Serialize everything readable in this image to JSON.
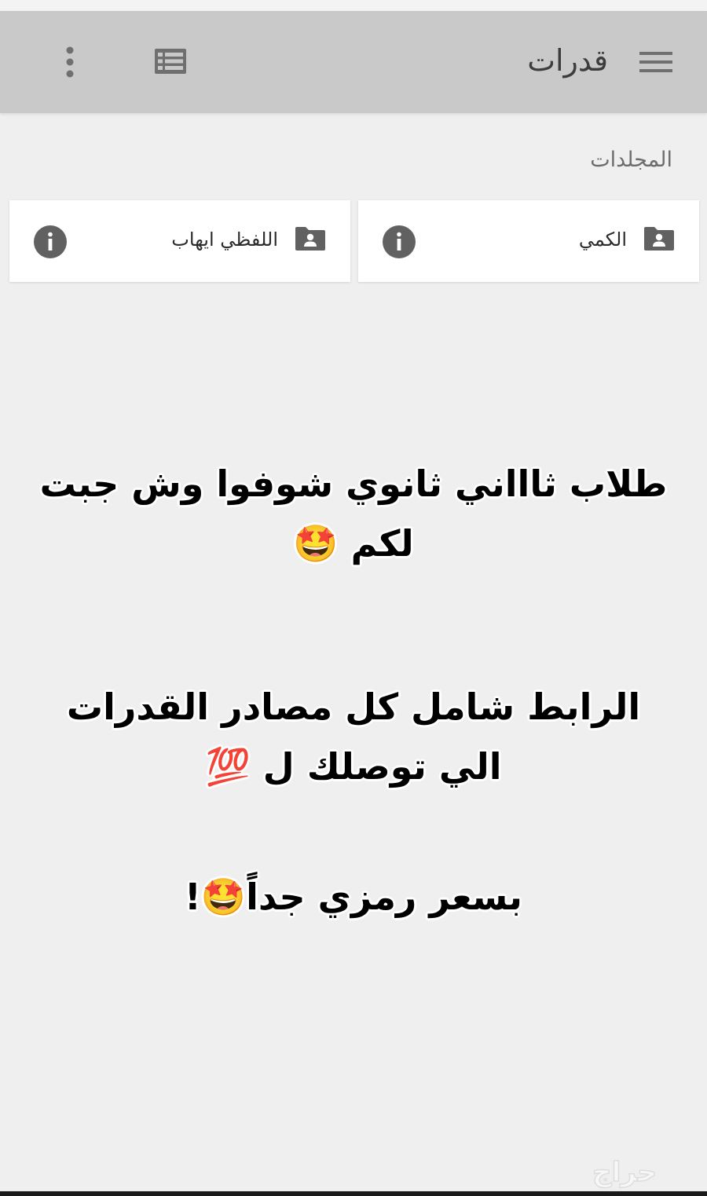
{
  "app_bar": {
    "title": "قدرات",
    "background": "#c9c9c9"
  },
  "folders_section": {
    "label": "المجلدات",
    "items": [
      {
        "name": "الكمي",
        "icon": "shared-folder-icon"
      },
      {
        "name": "اللفظي ايهاب",
        "icon": "shared-folder-icon"
      }
    ]
  },
  "overlay": {
    "line1": "طلاب ثاااني ثانوي شوفوا وش جبت لكم 🤩",
    "line2": "الرابط شامل كل مصادر القدرات الي توصلك ل 💯",
    "line3": "بسعر رمزي جداً🤩!"
  },
  "watermark": {
    "text": "حراج"
  }
}
